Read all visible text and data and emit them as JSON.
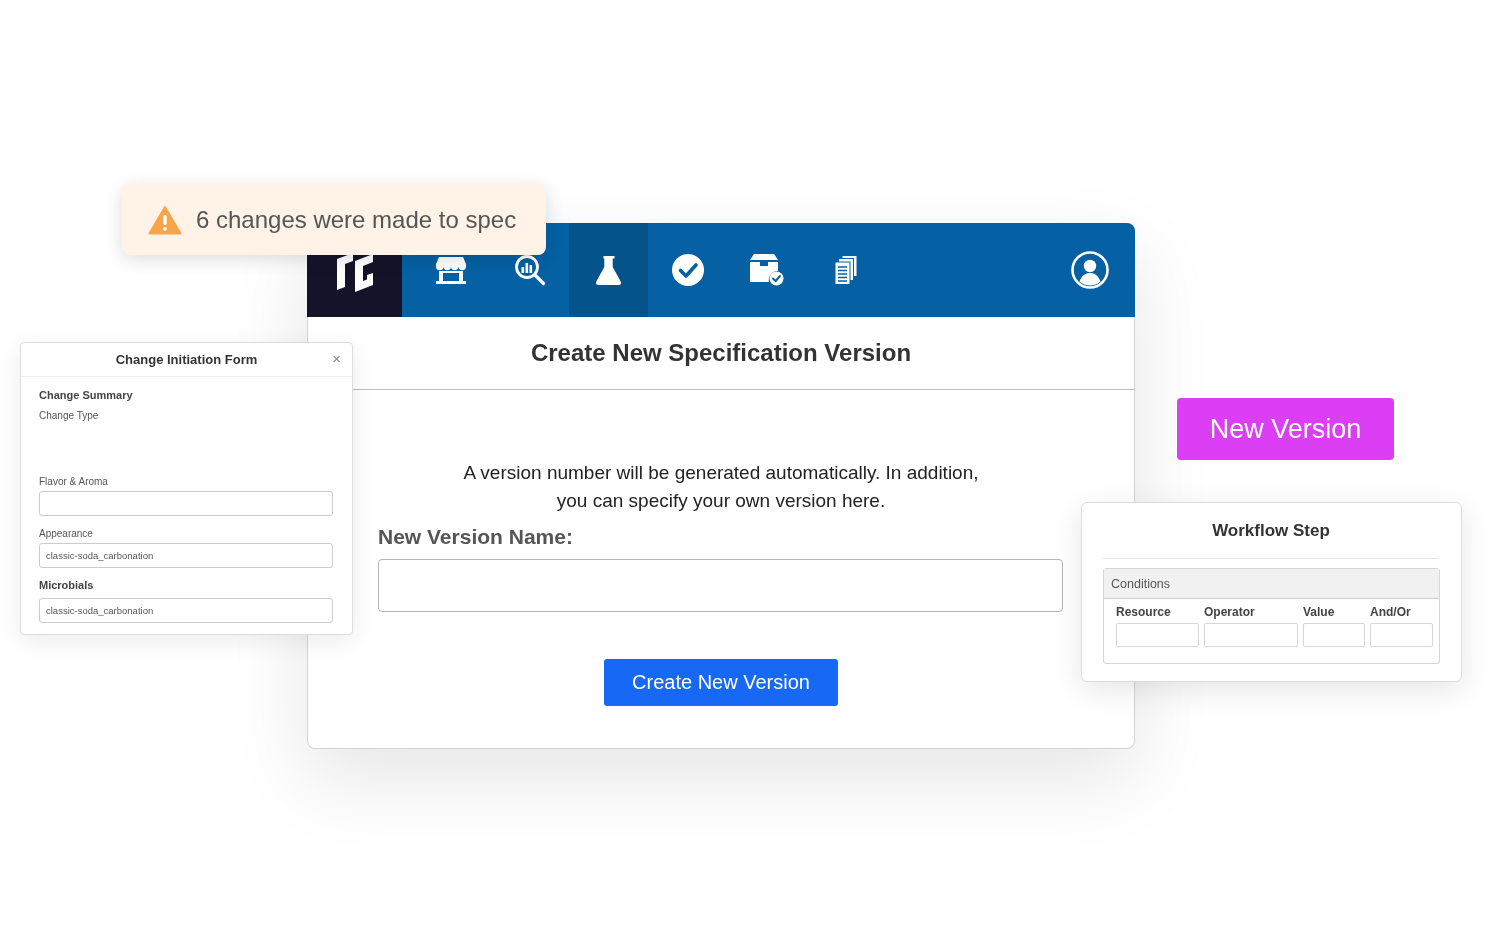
{
  "toast": {
    "text": "6 changes were made to spec"
  },
  "main_window": {
    "nav": {
      "items": [
        {
          "selected": false
        },
        {
          "selected": false
        },
        {
          "selected": true
        },
        {
          "selected": false
        },
        {
          "selected": false
        },
        {
          "selected": false
        }
      ]
    },
    "title": "Create New Specification Version",
    "intro": "A version number will be generated automatically. In addition,\nyou can specify your own version here.",
    "field_label": "New Version Name:",
    "submit_button": "Create New Version"
  },
  "change_form": {
    "title": "Change Initiation Form",
    "close": "×",
    "section": "Change Summary",
    "change_type_label": "Change Type",
    "fields": [
      {
        "label": "Flavor & Aroma",
        "bold": false
      },
      {
        "label": "Appearance",
        "value": "classic-soda_carbonation",
        "bold": false
      },
      {
        "label": "Microbials",
        "value": "classic-soda_carbonation",
        "bold": true
      }
    ]
  },
  "new_version_button": "New Version",
  "workflow_step": {
    "title": "Workflow Step",
    "conditions": {
      "title": "Conditions",
      "columns": [
        {
          "label": "Resource"
        },
        {
          "label": "Operator"
        },
        {
          "label": "Value"
        },
        {
          "label": "And/Or"
        }
      ]
    }
  }
}
